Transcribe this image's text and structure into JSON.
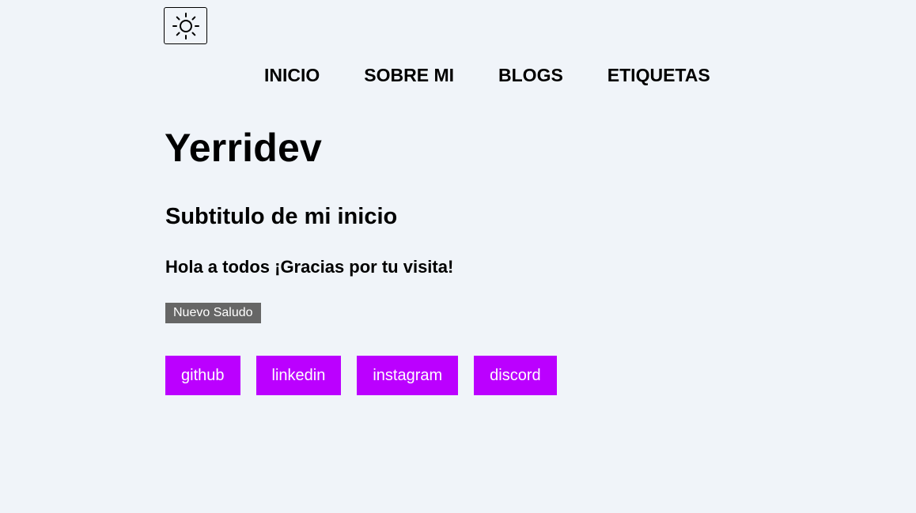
{
  "theme_toggle": {
    "icon": "sun-icon"
  },
  "nav": {
    "items": [
      {
        "label": "INICIO"
      },
      {
        "label": "SOBRE MI"
      },
      {
        "label": "BLOGS"
      },
      {
        "label": "ETIQUETAS"
      }
    ]
  },
  "main": {
    "title": "Yerridev",
    "subtitle": "Subtitulo de mi inicio",
    "greeting": "Hola a todos ¡Gracias por tu visita!",
    "greet_button_label": "Nuevo Saludo"
  },
  "socials": {
    "links": [
      {
        "label": "github"
      },
      {
        "label": "linkedin"
      },
      {
        "label": "instagram"
      },
      {
        "label": "discord"
      }
    ]
  },
  "colors": {
    "background": "#f0f4f9",
    "social_button": "#bb00ff",
    "greet_button": "#666666",
    "text": "#000000"
  }
}
